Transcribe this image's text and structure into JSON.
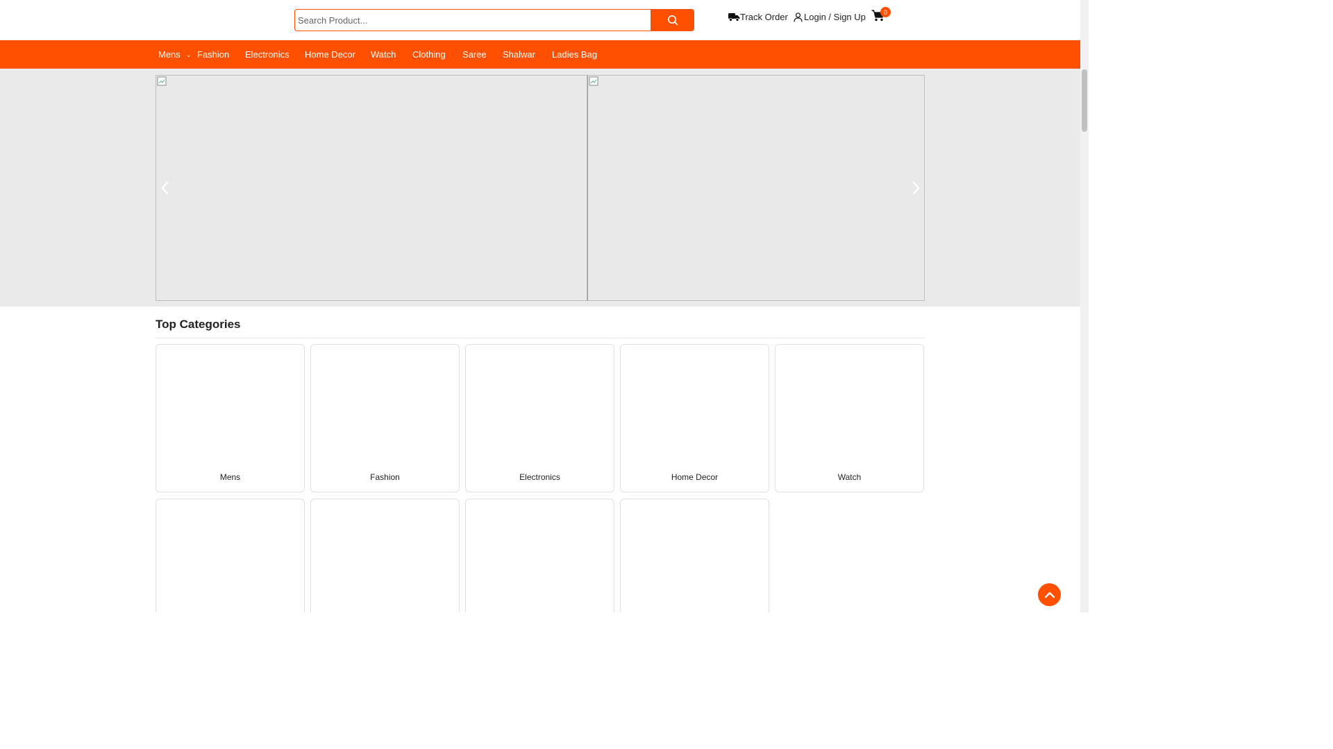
{
  "search": {
    "placeholder": "Search Product..."
  },
  "header": {
    "track_order": "Track Order",
    "login": "Login / Sign Up",
    "cart_count": "0"
  },
  "nav": {
    "items": [
      {
        "label": "Mens",
        "has_dropdown": true
      },
      {
        "label": "Fashion"
      },
      {
        "label": "Electronics"
      },
      {
        "label": "Home Decor"
      },
      {
        "label": "Watch"
      },
      {
        "label": "Clothing"
      },
      {
        "label": "Saree"
      },
      {
        "label": "Shalwar"
      },
      {
        "label": "Ladies Bag"
      }
    ]
  },
  "categories": {
    "title": "Top Categories",
    "items": [
      {
        "label": "Mens"
      },
      {
        "label": "Fashion"
      },
      {
        "label": "Electronics"
      },
      {
        "label": "Home Decor"
      },
      {
        "label": "Watch"
      },
      {
        "label": ""
      },
      {
        "label": ""
      },
      {
        "label": ""
      },
      {
        "label": ""
      }
    ]
  },
  "colors": {
    "brand": "#fe5000",
    "hero_bg": "#eaeaea"
  },
  "icons": [
    "search-icon",
    "truck-icon",
    "user-icon",
    "cart-icon",
    "chevron-left-icon",
    "chevron-right-icon",
    "chevron-up-icon",
    "chevron-down-icon",
    "broken-image-icon"
  ]
}
